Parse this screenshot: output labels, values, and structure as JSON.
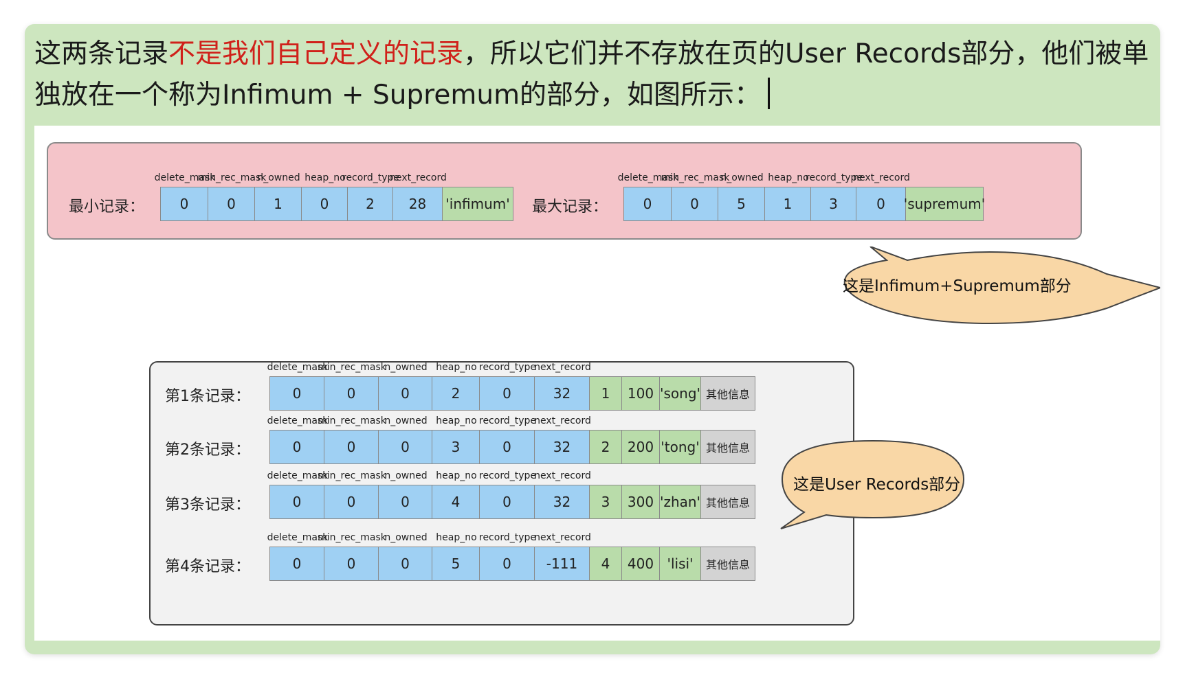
{
  "intro": {
    "part1": "这两条记录",
    "part2": "不是我们自己定义的记录",
    "part3": "，所以它们并不存放在页的User Records部分，他们被单独放在一个称为Infimum + Supremum的部分，如图所示："
  },
  "columns": [
    "delete_mask",
    "min_rec_mask",
    "n_owned",
    "heap_no",
    "record_type",
    "next_record"
  ],
  "top_records": [
    {
      "label": "最小记录：",
      "values": [
        "0",
        "0",
        "1",
        "0",
        "2",
        "28"
      ],
      "tag": "'infimum'"
    },
    {
      "label": "最大记录：",
      "values": [
        "0",
        "0",
        "5",
        "1",
        "3",
        "0"
      ],
      "tag": "'supremum'"
    }
  ],
  "user_records": [
    {
      "label": "第1条记录：",
      "values": [
        "0",
        "0",
        "0",
        "2",
        "0",
        "32"
      ],
      "extra": [
        "1",
        "100",
        "'song'"
      ],
      "other": "其他信息"
    },
    {
      "label": "第2条记录：",
      "values": [
        "0",
        "0",
        "0",
        "3",
        "0",
        "32"
      ],
      "extra": [
        "2",
        "200",
        "'tong'"
      ],
      "other": "其他信息"
    },
    {
      "label": "第3条记录：",
      "values": [
        "0",
        "0",
        "0",
        "4",
        "0",
        "32"
      ],
      "extra": [
        "3",
        "300",
        "'zhan'"
      ],
      "other": "其他信息"
    },
    {
      "label": "第4条记录：",
      "values": [
        "0",
        "0",
        "0",
        "5",
        "0",
        "-111"
      ],
      "extra": [
        "4",
        "400",
        "'lisi'"
      ],
      "other": "其他信息"
    }
  ],
  "callouts": {
    "infimum_supremum": "这是Infimum+Supremum部分",
    "user_records": "这是User Records部分"
  },
  "colors": {
    "frame_green": "#cde6bf",
    "highlight_red": "#d0201a",
    "panel_pink": "#f4c4c9",
    "cell_blue": "#9fd0f3",
    "cell_green": "#b9dcaa",
    "cell_gray": "#d3d3d3",
    "callout_fill": "#f9d7a6"
  }
}
